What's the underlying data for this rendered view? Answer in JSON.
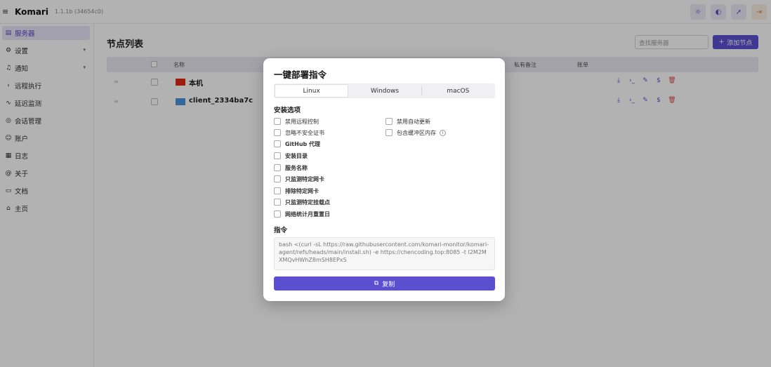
{
  "app": {
    "name": "Komari",
    "version": "1.1.1b (34654c0)"
  },
  "topbar": {
    "icons": [
      "sun-icon",
      "moon-icon",
      "rocket-icon",
      "logout-icon"
    ]
  },
  "sidebar": {
    "items": [
      {
        "label": "服务器",
        "icon": "server-icon",
        "active": true
      },
      {
        "label": "设置",
        "icon": "gear-icon",
        "chevron": true
      },
      {
        "label": "通知",
        "icon": "bell-icon",
        "chevron": true
      },
      {
        "label": "远程执行",
        "icon": "terminal-icon"
      },
      {
        "label": "延迟监测",
        "icon": "pulse-icon"
      },
      {
        "label": "会话管理",
        "icon": "session-icon"
      },
      {
        "label": "账户",
        "icon": "user-icon"
      },
      {
        "label": "日志",
        "icon": "log-icon"
      },
      {
        "label": "关于",
        "icon": "info-icon"
      },
      {
        "label": "文档",
        "icon": "doc-icon"
      },
      {
        "label": "主页",
        "icon": "home-icon"
      }
    ]
  },
  "main": {
    "title": "节点列表",
    "search_placeholder": "查找服务器",
    "add_button": "添加节点",
    "columns": {
      "name": "名称",
      "note": "私有备注",
      "billing": "账单"
    },
    "rows": [
      {
        "name": "本机",
        "flag": "cn"
      },
      {
        "name": "client_2334ba7c",
        "flag": "un"
      }
    ]
  },
  "modal": {
    "title": "一键部署指令",
    "tabs": [
      "Linux",
      "Windows",
      "macOS"
    ],
    "active_tab": "Linux",
    "install_options_label": "安装选项",
    "options_left": [
      {
        "label": "禁用远程控制",
        "bold": false
      },
      {
        "label": "忽略不安全证书",
        "bold": false
      },
      {
        "label": "GitHub 代理",
        "bold": true
      },
      {
        "label": "安装目录",
        "bold": true
      },
      {
        "label": "服务名称",
        "bold": true
      },
      {
        "label": "只监测特定网卡",
        "bold": true
      },
      {
        "label": "排除特定网卡",
        "bold": true
      },
      {
        "label": "只监测特定挂载点",
        "bold": true
      },
      {
        "label": "网络统计月重置日",
        "bold": true
      }
    ],
    "options_right": [
      {
        "label": "禁用自动更新",
        "info": false
      },
      {
        "label": "包含缓冲区内存",
        "info": true
      }
    ],
    "command_label": "指令",
    "command": "bash <(curl -sL https://raw.githubusercontent.com/komari-monitor/komari-agent/refs/heads/main/install.sh) -e https://chencoding.top:8085 -t I2M2MXMQvHWhZ8mSH8EPxS",
    "copy_button": "复制"
  }
}
